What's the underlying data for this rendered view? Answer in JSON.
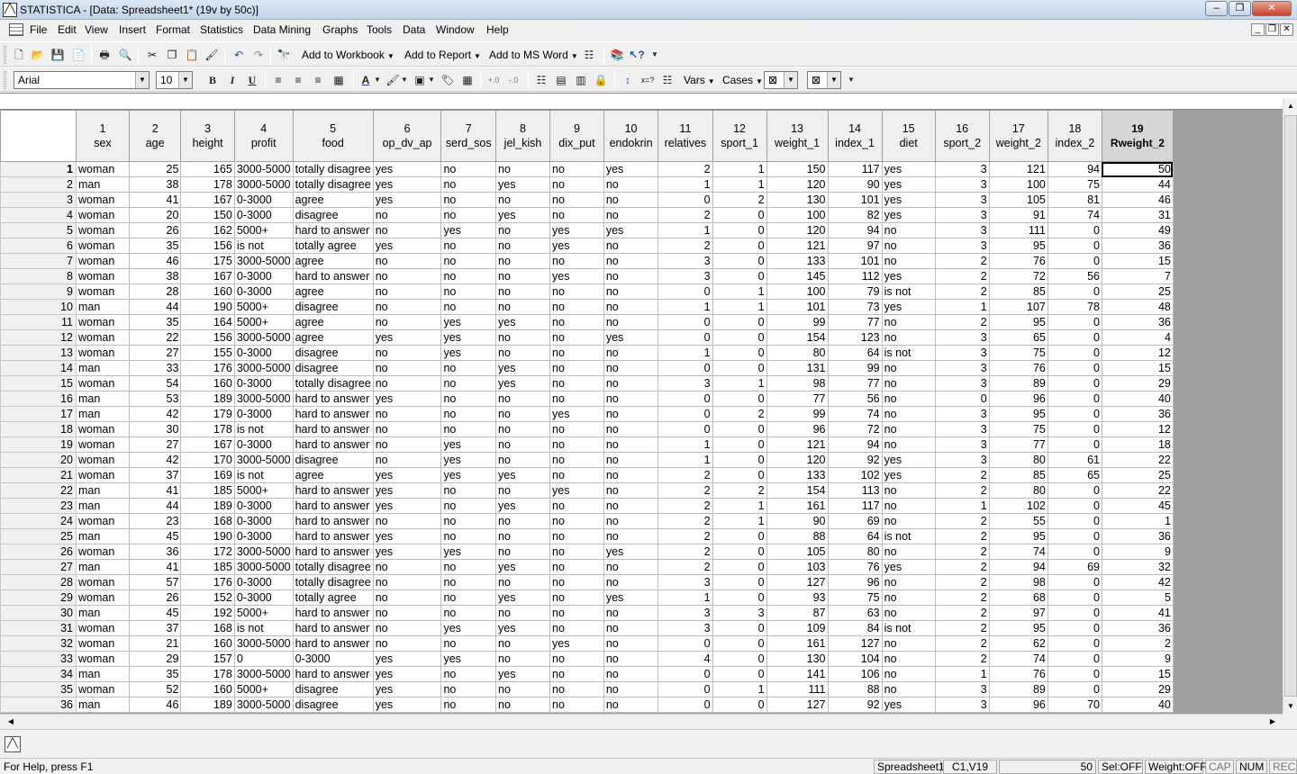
{
  "app": {
    "title": "STATISTICA - [Data: Spreadsheet1* (19v by 50c)]",
    "app_icon": "statistica-logo-icon"
  },
  "menu": [
    "File",
    "Edit",
    "View",
    "Insert",
    "Format",
    "Statistics",
    "Data Mining",
    "Graphs",
    "Tools",
    "Data",
    "Window",
    "Help"
  ],
  "toolbar1": {
    "add_to_workbook": "Add to Workbook",
    "add_to_report": "Add to Report",
    "add_to_ms_word": "Add to MS Word",
    "help_glyph": "❓"
  },
  "toolbar2": {
    "font_name": "Arial",
    "font_size": "10",
    "bold": "B",
    "italic": "I",
    "underline": "U",
    "vars_label": "Vars",
    "cases_label": "Cases"
  },
  "columns": [
    {
      "num": "1",
      "name": "sex",
      "type": "txt",
      "width": 60
    },
    {
      "num": "2",
      "name": "age",
      "type": "num",
      "width": 60
    },
    {
      "num": "3",
      "name": "height",
      "type": "num",
      "width": 61
    },
    {
      "num": "4",
      "name": "profit",
      "type": "txt",
      "width": 61
    },
    {
      "num": "5",
      "name": "food",
      "type": "txt",
      "width": 61
    },
    {
      "num": "6",
      "name": "op_dv_ap",
      "type": "txt",
      "width": 77
    },
    {
      "num": "7",
      "name": "serd_sos",
      "type": "txt",
      "width": 61
    },
    {
      "num": "8",
      "name": "jel_kish",
      "type": "txt",
      "width": 61
    },
    {
      "num": "9",
      "name": "dix_put",
      "type": "txt",
      "width": 61
    },
    {
      "num": "10",
      "name": "endokrin",
      "type": "txt",
      "width": 61
    },
    {
      "num": "11",
      "name": "relatives",
      "type": "num",
      "width": 61
    },
    {
      "num": "12",
      "name": "sport_1",
      "type": "num",
      "width": 61
    },
    {
      "num": "13",
      "name": "weight_1",
      "type": "num",
      "width": 69
    },
    {
      "num": "14",
      "name": "index_1",
      "type": "num",
      "width": 61
    },
    {
      "num": "15",
      "name": "diet",
      "type": "txt",
      "width": 61
    },
    {
      "num": "16",
      "name": "sport_2",
      "type": "num",
      "width": 61
    },
    {
      "num": "17",
      "name": "weight_2",
      "type": "num",
      "width": 66
    },
    {
      "num": "18",
      "name": "index_2",
      "type": "num",
      "width": 61
    },
    {
      "num": "19",
      "name": "Rweight_2",
      "type": "num",
      "width": 80
    }
  ],
  "rows": [
    [
      "woman",
      "25",
      "165",
      "3000-5000",
      "totally disagree",
      "yes",
      "no",
      "no",
      "no",
      "yes",
      "2",
      "1",
      "150",
      "117",
      "yes",
      "3",
      "121",
      "94",
      "50"
    ],
    [
      "man",
      "38",
      "178",
      "3000-5000",
      "totally disagree",
      "yes",
      "no",
      "yes",
      "no",
      "no",
      "1",
      "1",
      "120",
      "90",
      "yes",
      "3",
      "100",
      "75",
      "44"
    ],
    [
      "woman",
      "41",
      "167",
      "0-3000",
      "agree",
      "yes",
      "no",
      "no",
      "no",
      "no",
      "0",
      "2",
      "130",
      "101",
      "yes",
      "3",
      "105",
      "81",
      "46"
    ],
    [
      "woman",
      "20",
      "150",
      "0-3000",
      "disagree",
      "no",
      "no",
      "yes",
      "no",
      "no",
      "2",
      "0",
      "100",
      "82",
      "yes",
      "3",
      "91",
      "74",
      "31"
    ],
    [
      "woman",
      "26",
      "162",
      "5000+",
      "hard to answer",
      "no",
      "yes",
      "no",
      "yes",
      "yes",
      "1",
      "0",
      "120",
      "94",
      "no",
      "3",
      "111",
      "0",
      "49"
    ],
    [
      "woman",
      "35",
      "156",
      "is not",
      "totally agree",
      "yes",
      "no",
      "no",
      "yes",
      "no",
      "2",
      "0",
      "121",
      "97",
      "no",
      "3",
      "95",
      "0",
      "36"
    ],
    [
      "woman",
      "46",
      "175",
      "3000-5000",
      "agree",
      "no",
      "no",
      "no",
      "no",
      "no",
      "3",
      "0",
      "133",
      "101",
      "no",
      "2",
      "76",
      "0",
      "15"
    ],
    [
      "woman",
      "38",
      "167",
      "0-3000",
      "hard to answer",
      "no",
      "no",
      "no",
      "yes",
      "no",
      "3",
      "0",
      "145",
      "112",
      "yes",
      "2",
      "72",
      "56",
      "7"
    ],
    [
      "woman",
      "28",
      "160",
      "0-3000",
      "agree",
      "no",
      "no",
      "no",
      "no",
      "no",
      "0",
      "1",
      "100",
      "79",
      "is not",
      "2",
      "85",
      "0",
      "25"
    ],
    [
      "man",
      "44",
      "190",
      "5000+",
      "disagree",
      "no",
      "no",
      "no",
      "no",
      "no",
      "1",
      "1",
      "101",
      "73",
      "yes",
      "1",
      "107",
      "78",
      "48"
    ],
    [
      "woman",
      "35",
      "164",
      "5000+",
      "agree",
      "no",
      "yes",
      "yes",
      "no",
      "no",
      "0",
      "0",
      "99",
      "77",
      "no",
      "2",
      "95",
      "0",
      "36"
    ],
    [
      "woman",
      "22",
      "156",
      "3000-5000",
      "agree",
      "yes",
      "yes",
      "no",
      "no",
      "yes",
      "0",
      "0",
      "154",
      "123",
      "no",
      "3",
      "65",
      "0",
      "4"
    ],
    [
      "woman",
      "27",
      "155",
      "0-3000",
      "disagree",
      "no",
      "yes",
      "no",
      "no",
      "no",
      "1",
      "0",
      "80",
      "64",
      "is not",
      "3",
      "75",
      "0",
      "12"
    ],
    [
      "man",
      "33",
      "176",
      "3000-5000",
      "disagree",
      "no",
      "no",
      "yes",
      "no",
      "no",
      "0",
      "0",
      "131",
      "99",
      "no",
      "3",
      "76",
      "0",
      "15"
    ],
    [
      "woman",
      "54",
      "160",
      "0-3000",
      "totally disagree",
      "no",
      "no",
      "yes",
      "no",
      "no",
      "3",
      "1",
      "98",
      "77",
      "no",
      "3",
      "89",
      "0",
      "29"
    ],
    [
      "man",
      "53",
      "189",
      "3000-5000",
      "hard to answer",
      "yes",
      "no",
      "no",
      "no",
      "no",
      "0",
      "0",
      "77",
      "56",
      "no",
      "0",
      "96",
      "0",
      "40"
    ],
    [
      "man",
      "42",
      "179",
      "0-3000",
      "hard to answer",
      "no",
      "no",
      "no",
      "yes",
      "no",
      "0",
      "2",
      "99",
      "74",
      "no",
      "3",
      "95",
      "0",
      "36"
    ],
    [
      "woman",
      "30",
      "178",
      "is not",
      "hard to answer",
      "no",
      "no",
      "no",
      "no",
      "no",
      "0",
      "0",
      "96",
      "72",
      "no",
      "3",
      "75",
      "0",
      "12"
    ],
    [
      "woman",
      "27",
      "167",
      "0-3000",
      "hard to answer",
      "no",
      "yes",
      "no",
      "no",
      "no",
      "1",
      "0",
      "121",
      "94",
      "no",
      "3",
      "77",
      "0",
      "18"
    ],
    [
      "woman",
      "42",
      "170",
      "3000-5000",
      "disagree",
      "no",
      "yes",
      "no",
      "no",
      "no",
      "1",
      "0",
      "120",
      "92",
      "yes",
      "3",
      "80",
      "61",
      "22"
    ],
    [
      "woman",
      "37",
      "169",
      "is not",
      "agree",
      "yes",
      "yes",
      "yes",
      "no",
      "no",
      "2",
      "0",
      "133",
      "102",
      "yes",
      "2",
      "85",
      "65",
      "25"
    ],
    [
      "man",
      "41",
      "185",
      "5000+",
      "hard to answer",
      "yes",
      "no",
      "no",
      "yes",
      "no",
      "2",
      "2",
      "154",
      "113",
      "no",
      "2",
      "80",
      "0",
      "22"
    ],
    [
      "man",
      "44",
      "189",
      "0-3000",
      "hard to answer",
      "yes",
      "no",
      "yes",
      "no",
      "no",
      "2",
      "1",
      "161",
      "117",
      "no",
      "1",
      "102",
      "0",
      "45"
    ],
    [
      "woman",
      "23",
      "168",
      "0-3000",
      "hard to answer",
      "no",
      "no",
      "no",
      "no",
      "no",
      "2",
      "1",
      "90",
      "69",
      "no",
      "2",
      "55",
      "0",
      "1"
    ],
    [
      "man",
      "45",
      "190",
      "0-3000",
      "hard to answer",
      "yes",
      "no",
      "no",
      "no",
      "no",
      "2",
      "0",
      "88",
      "64",
      "is not",
      "2",
      "95",
      "0",
      "36"
    ],
    [
      "woman",
      "36",
      "172",
      "3000-5000",
      "hard to answer",
      "yes",
      "yes",
      "no",
      "no",
      "yes",
      "2",
      "0",
      "105",
      "80",
      "no",
      "2",
      "74",
      "0",
      "9"
    ],
    [
      "man",
      "41",
      "185",
      "3000-5000",
      "totally disagree",
      "no",
      "no",
      "yes",
      "no",
      "no",
      "2",
      "0",
      "103",
      "76",
      "yes",
      "2",
      "94",
      "69",
      "32"
    ],
    [
      "woman",
      "57",
      "176",
      "0-3000",
      "totally disagree",
      "no",
      "no",
      "no",
      "no",
      "no",
      "3",
      "0",
      "127",
      "96",
      "no",
      "2",
      "98",
      "0",
      "42"
    ],
    [
      "woman",
      "26",
      "152",
      "0-3000",
      "totally agree",
      "no",
      "no",
      "yes",
      "no",
      "yes",
      "1",
      "0",
      "93",
      "75",
      "no",
      "2",
      "68",
      "0",
      "5"
    ],
    [
      "man",
      "45",
      "192",
      "5000+",
      "hard to answer",
      "no",
      "no",
      "no",
      "no",
      "no",
      "3",
      "3",
      "87",
      "63",
      "no",
      "2",
      "97",
      "0",
      "41"
    ],
    [
      "woman",
      "37",
      "168",
      "is not",
      "hard to answer",
      "no",
      "yes",
      "yes",
      "no",
      "no",
      "3",
      "0",
      "109",
      "84",
      "is not",
      "2",
      "95",
      "0",
      "36"
    ],
    [
      "woman",
      "21",
      "160",
      "3000-5000",
      "hard to answer",
      "no",
      "no",
      "no",
      "yes",
      "no",
      "0",
      "0",
      "161",
      "127",
      "no",
      "2",
      "62",
      "0",
      "2"
    ],
    [
      "woman",
      "29",
      "157",
      "0",
      "0-3000",
      "yes",
      "yes",
      "no",
      "no",
      "no",
      "4",
      "0",
      "130",
      "104",
      "no",
      "2",
      "74",
      "0",
      "9"
    ],
    [
      "man",
      "35",
      "178",
      "3000-5000",
      "hard to answer",
      "yes",
      "no",
      "yes",
      "no",
      "no",
      "0",
      "0",
      "141",
      "106",
      "no",
      "1",
      "76",
      "0",
      "15"
    ],
    [
      "woman",
      "52",
      "160",
      "5000+",
      "disagree",
      "yes",
      "no",
      "no",
      "no",
      "no",
      "0",
      "1",
      "111",
      "88",
      "no",
      "3",
      "89",
      "0",
      "29"
    ],
    [
      "man",
      "46",
      "189",
      "3000-5000",
      "disagree",
      "yes",
      "no",
      "no",
      "no",
      "no",
      "0",
      "0",
      "127",
      "92",
      "yes",
      "3",
      "96",
      "70",
      "40"
    ]
  ],
  "active_cell": {
    "row": 1,
    "col": 19
  },
  "status": {
    "help": "For Help, press F1",
    "sheet": "Spreadsheet1",
    "cell": "C1,V19",
    "value": "50",
    "sel": "Sel:OFF",
    "weight": "Weight:OFF",
    "cap": "CAP",
    "num": "NUM",
    "rec": "REC"
  },
  "colors": {
    "header_bg": "#f0f0f0",
    "grid_bg": "#a0a0a0",
    "title_bg": "#c3d5ea"
  }
}
